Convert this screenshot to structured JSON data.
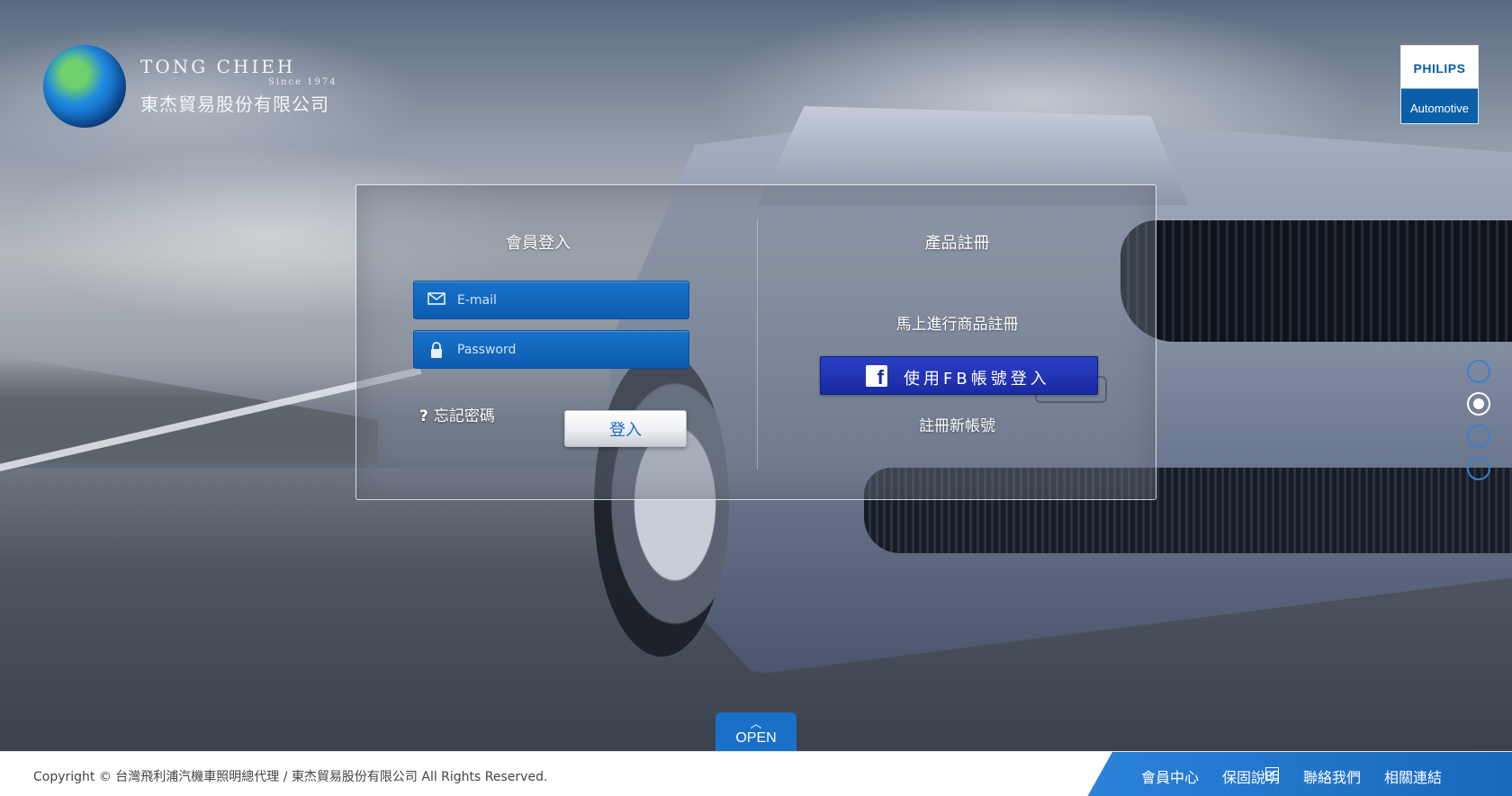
{
  "brand": {
    "logo_en": "TONG CHIEH",
    "logo_since": "Since 1974",
    "logo_zh": "東杰貿易股份有限公司",
    "partner_name": "PHILIPS",
    "partner_sub": "Automotive"
  },
  "login": {
    "title": "會員登入",
    "email_placeholder": "E-mail",
    "password_placeholder": "Password",
    "email_icon": "mail-icon",
    "password_icon": "lock-icon",
    "forgot_label": "忘記密碼",
    "submit_label": "登入"
  },
  "register": {
    "title": "產品註冊",
    "hint": "馬上進行商品註冊",
    "fb_label": "使用FB帳號登入",
    "new_account_label": "註冊新帳號"
  },
  "slider": {
    "count": 4,
    "active_index": 1
  },
  "open_tab": {
    "label": "OPEN"
  },
  "footer": {
    "copyright": "Copyright © 台灣飛利浦汽機車照明總代理 / 東杰貿易股份有限公司 All Rights Reserved.",
    "links": [
      "會員中心",
      "保固說明",
      "聯絡我們",
      "相關連結"
    ]
  },
  "colors": {
    "accent": "#1a6fc8",
    "facebook": "#1a2aa3",
    "philips_blue": "#0b5ea8"
  }
}
